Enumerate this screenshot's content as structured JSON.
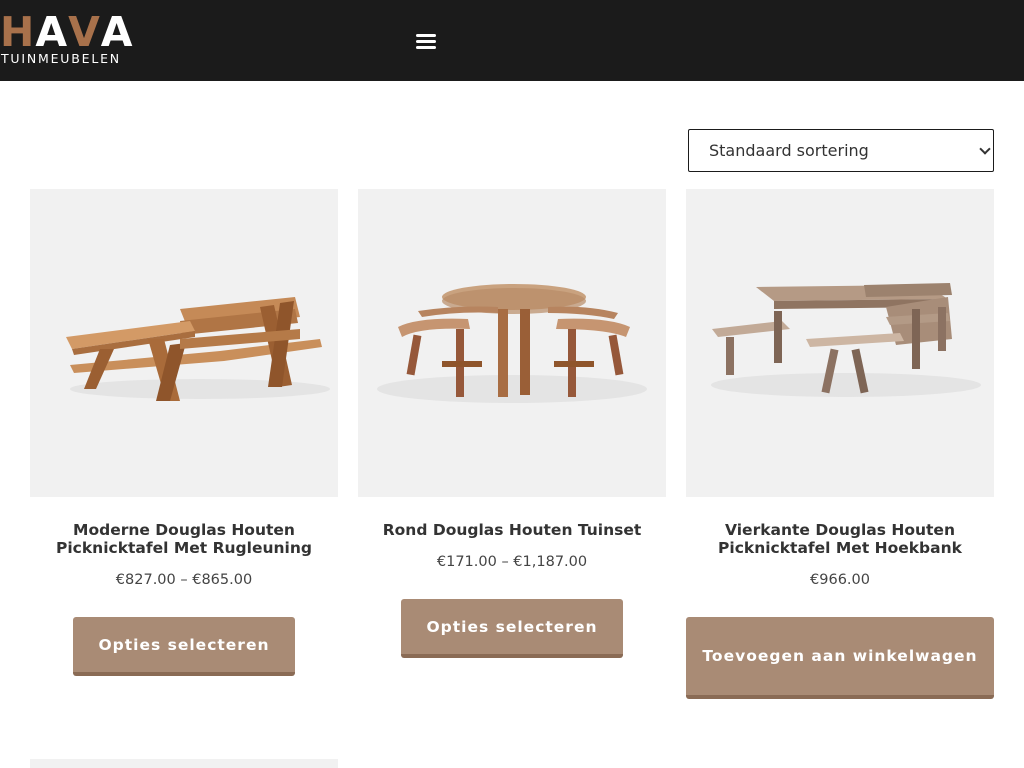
{
  "header": {
    "logo": {
      "letters": [
        {
          "char": "H",
          "color": "#a8714b"
        },
        {
          "char": "A",
          "color": "#ffffff"
        },
        {
          "char": "V",
          "color": "#a8714b"
        },
        {
          "char": "A",
          "color": "#ffffff"
        }
      ],
      "tagline": "TUINMEUBELEN"
    },
    "menu_icon": "hamburger-menu-icon"
  },
  "sorting": {
    "selected": "Standaard sortering"
  },
  "products": [
    {
      "title": "Moderne Douglas Houten Picknicktafel Met Rugleuning",
      "price": "€827.00 – €865.00",
      "button": "Opties selecteren"
    },
    {
      "title": "Rond Douglas Houten Tuinset",
      "price": "€171.00 – €1,187.00",
      "button": "Opties selecteren"
    },
    {
      "title": "Vierkante Douglas Houten Picknicktafel Met Hoekbank",
      "price": "€966.00",
      "button": "Toevoegen aan winkelwagen"
    }
  ],
  "colors": {
    "header_bg": "#1b1b1b",
    "button_bg": "#a98b75",
    "button_shadow": "#8a6b55",
    "logo_accent": "#a8714b",
    "card_bg": "#f1f1f1"
  }
}
